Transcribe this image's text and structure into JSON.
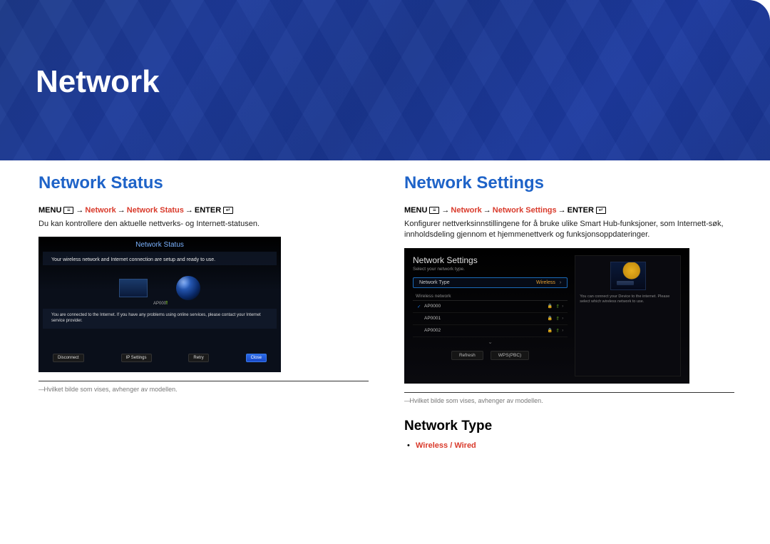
{
  "banner": {
    "title": "Network"
  },
  "left": {
    "heading": "Network Status",
    "path": {
      "menu": "MENU",
      "p1": "Network",
      "p2": "Network Status",
      "enter": "ENTER"
    },
    "desc": "Du kan kontrollere den aktuelle nettverks- og Internett-statusen.",
    "shot": {
      "title": "Network Status",
      "msg": "Your wireless network and Internet connection are setup and ready to use.",
      "ap": "AP000",
      "info": "You are connected to the Internet. If you have any problems using online services, please contact your Internet service provider.",
      "btns": [
        "Disconnect",
        "IP Settings",
        "Retry",
        "Close"
      ]
    },
    "note": "Hvilket bilde som vises, avhenger av modellen."
  },
  "right": {
    "heading": "Network Settings",
    "path": {
      "menu": "MENU",
      "p1": "Network",
      "p2": "Network Settings",
      "enter": "ENTER"
    },
    "desc": "Konfigurer nettverksinnstillingene for å bruke ulike Smart Hub-funksjoner, som Internett-søk, innholdsdeling gjennom et hjemmenettverk og funksjonsoppdateringer.",
    "shot": {
      "title": "Network Settings",
      "sub": "Select your network type.",
      "nt_label": "Network Type",
      "nt_value": "Wireless",
      "wn_label": "Wireless network",
      "aps": [
        {
          "name": "AP0000",
          "checked": true
        },
        {
          "name": "AP0001",
          "checked": false
        },
        {
          "name": "AP0002",
          "checked": false
        }
      ],
      "btns": [
        "Refresh",
        "WPS(PBC)"
      ],
      "side": "You can connect your Device to the internet. Please select which wireless network to use."
    },
    "note": "Hvilket bilde som vises, avhenger av modellen.",
    "subsection": "Network Type",
    "option": "Wireless / Wired"
  }
}
